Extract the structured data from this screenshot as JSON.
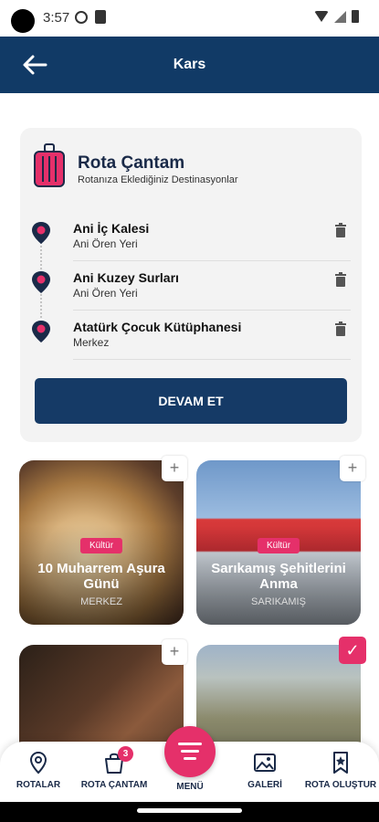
{
  "status_bar": {
    "time": "3:57"
  },
  "header": {
    "title": "Kars",
    "back_label": "←"
  },
  "route_bag": {
    "title": "Rota Çantam",
    "subtitle": "Rotanıza Eklediğiniz Destinasyonlar",
    "destinations": [
      {
        "name": "Ani İç Kalesi",
        "location": "Ani Ören Yeri"
      },
      {
        "name": "Ani Kuzey Surları",
        "location": "Ani Ören Yeri"
      },
      {
        "name": "Atatürk Çocuk Kütüphanesi",
        "location": "Merkez"
      }
    ],
    "continue_label": "DEVAM ET"
  },
  "tiles": [
    {
      "badge": "Kültür",
      "title": "10 Muharrem Aşura Günü",
      "location": "MERKEZ",
      "added": false,
      "add_label": "+"
    },
    {
      "badge": "Kültür",
      "title": "Sarıkamış Şehitlerini Anma",
      "location": "SARIKAMIŞ",
      "added": false,
      "add_label": "+"
    },
    {
      "badge": "",
      "title": "",
      "location": "",
      "added": false,
      "add_label": "+"
    },
    {
      "badge": "",
      "title": "",
      "location": "",
      "added": true,
      "add_label": "✓"
    }
  ],
  "bottom_nav": {
    "items": [
      {
        "label": "ROTALAR",
        "icon": "map-pin-icon"
      },
      {
        "label": "ROTA ÇANTAM",
        "icon": "bag-icon",
        "badge": "3"
      },
      {
        "label": "MENÜ",
        "icon": "menu-icon"
      },
      {
        "label": "GALERİ",
        "icon": "gallery-icon"
      },
      {
        "label": "ROTA OLUŞTUR",
        "icon": "route-create-icon"
      }
    ]
  },
  "colors": {
    "primary": "#113a66",
    "accent": "#e5306a",
    "card_bg": "#f3f3f3"
  }
}
